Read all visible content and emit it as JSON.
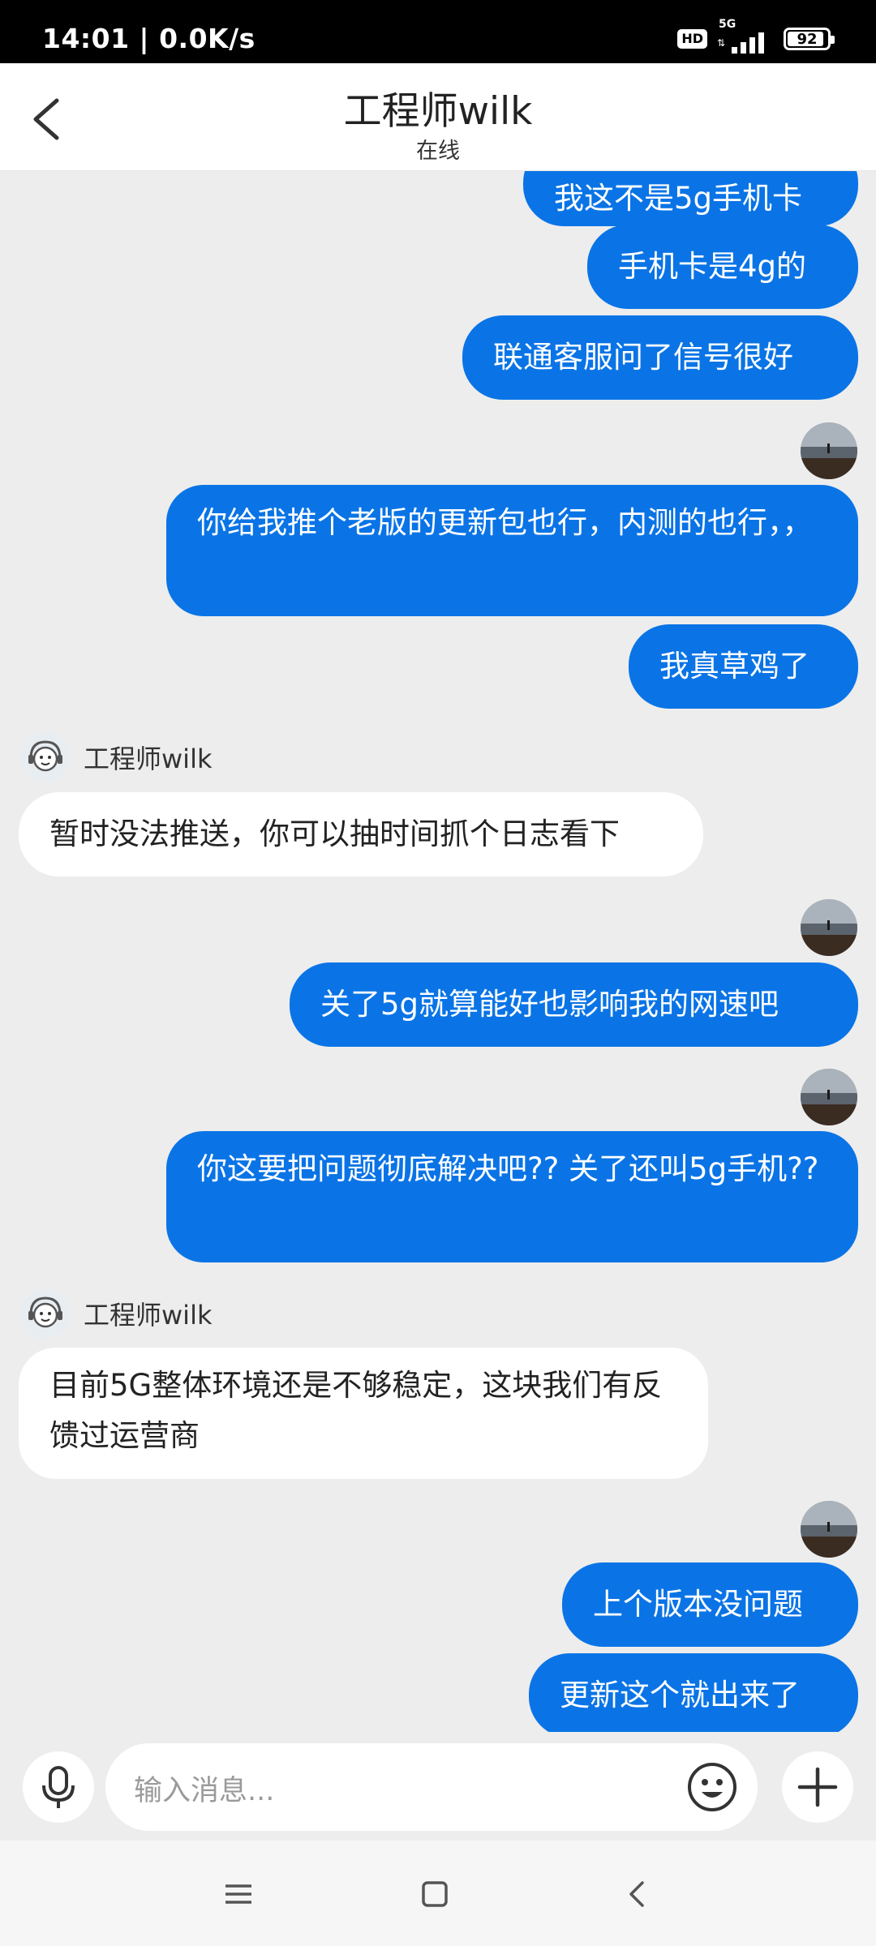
{
  "status_bar": {
    "time": "14:01 | 0.0K/s",
    "hd": "HD",
    "network": "5G",
    "battery": "92",
    "battery_level": 0.92
  },
  "header": {
    "title": "工程师wilk",
    "subtitle": "在线",
    "back_icon": "chevron-left-icon"
  },
  "messages": [
    {
      "from": "me",
      "text": "我这不是5g手机卡"
    },
    {
      "from": "me",
      "text": "手机卡是4g的"
    },
    {
      "from": "me",
      "text": "联通客服问了信号很好"
    },
    {
      "from": "me",
      "text": "你给我推个老版的更新包也行，内测的也行，，"
    },
    {
      "from": "me",
      "text": "我真草鸡了"
    },
    {
      "from": "agent",
      "name": "工程师wilk",
      "text": "暂时没法推送，你可以抽时间抓个日志看下"
    },
    {
      "from": "me",
      "text": "关了5g就算能好也影响我的网速吧"
    },
    {
      "from": "me",
      "text": "你这要把问题彻底解决吧?? 关了还叫5g手机??"
    },
    {
      "from": "agent",
      "name": "工程师wilk",
      "text": "目前5G整体环境还是不够稳定，这块我们有反馈过运营商"
    },
    {
      "from": "me",
      "text": "上个版本没问题"
    },
    {
      "from": "me",
      "text": "更新这个就出来了"
    }
  ],
  "input_bar": {
    "placeholder": "输入消息...",
    "mic_icon": "microphone-icon",
    "emoji_icon": "emoji-icon",
    "plus_icon": "plus-icon"
  },
  "nav_bar": {
    "icons": [
      "menu-icon",
      "home-square-icon",
      "back-triangle-icon"
    ]
  },
  "colors": {
    "outgoing_bubble": "#0a74e6",
    "incoming_bubble": "#ffffff",
    "chat_background": "#ededed"
  }
}
